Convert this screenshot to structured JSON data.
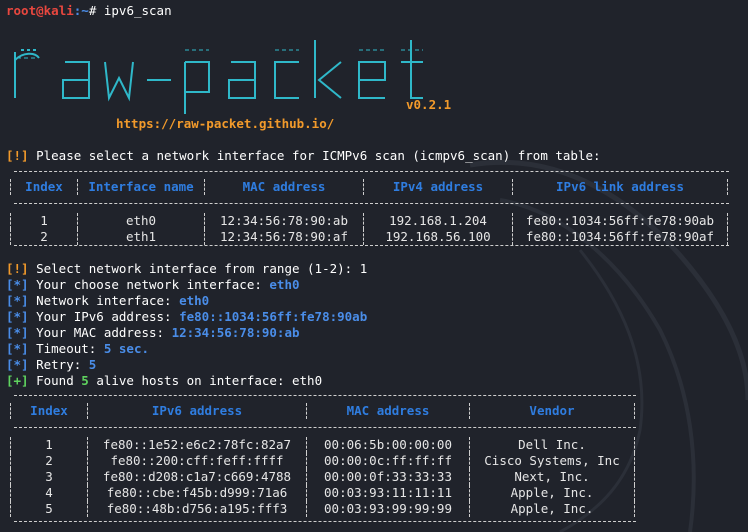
{
  "prompt": {
    "user": "root",
    "at": "@",
    "host": "kali",
    "path": ":~",
    "hash": "#",
    "command": " ipv6_scan"
  },
  "banner": {
    "version": "v0.2.1",
    "url": "https://raw-packet.github.io/"
  },
  "section1": {
    "select_msg_tag": "[!]",
    "select_msg": " Please select a network interface for ICMPv6 scan (icmpv6_scan) from table:",
    "headers": [
      "Index",
      "Interface name",
      "MAC address",
      "IPv4 address",
      "IPv6 link address"
    ],
    "rows": [
      [
        "1",
        "eth0",
        "12:34:56:78:90:ab",
        "192.168.1.204",
        "fe80::1034:56ff:fe78:90ab"
      ],
      [
        "2",
        "eth1",
        "12:34:56:78:90:af",
        "192.168.56.100",
        "fe80::1034:56ff:fe78:90af"
      ]
    ]
  },
  "log": [
    {
      "tag": "[!]",
      "kind": "orange",
      "text": " Select network interface from range (1-2): 1",
      "val": ""
    },
    {
      "tag": "[*]",
      "kind": "blue",
      "text": " Your choose network interface: ",
      "val": "eth0"
    },
    {
      "tag": "[*]",
      "kind": "blue",
      "text": " Network interface: ",
      "val": "eth0"
    },
    {
      "tag": "[*]",
      "kind": "blue",
      "text": " Your IPv6 address: ",
      "val": "fe80::1034:56ff:fe78:90ab"
    },
    {
      "tag": "[*]",
      "kind": "blue",
      "text": " Your MAC address: ",
      "val": "12:34:56:78:90:ab"
    },
    {
      "tag": "[*]",
      "kind": "blue",
      "text": " Timeout: ",
      "val": "5 sec."
    },
    {
      "tag": "[*]",
      "kind": "blue",
      "text": " Retry: ",
      "val": "5"
    },
    {
      "tag": "[+]",
      "kind": "green",
      "text": " Found ",
      "val": "5",
      "text2": " alive hosts on interface: ",
      "val2": "eth0"
    }
  ],
  "section2": {
    "headers": [
      "Index",
      "IPv6 address",
      "MAC address",
      "Vendor"
    ],
    "rows": [
      [
        "1",
        "fe80::1e52:e6c2:78fc:82a7",
        "00:06:5b:00:00:00",
        "Dell Inc."
      ],
      [
        "2",
        "fe80::200:cff:feff:ffff",
        "00:00:0c:ff:ff:ff",
        "Cisco Systems, Inc"
      ],
      [
        "3",
        "fe80::d208:c1a7:c669:4788",
        "00:00:0f:33:33:33",
        "Next, Inc."
      ],
      [
        "4",
        "fe80::cbe:f45b:d999:71a6",
        "00:03:93:11:11:11",
        "Apple, Inc."
      ],
      [
        "5",
        "fe80::48b:d756:a195:fff3",
        "00:03:93:99:99:99",
        "Apple, Inc."
      ]
    ]
  },
  "colors": {
    "bg": "#20232b",
    "red": "#e8473f",
    "blue": "#4a8de8",
    "cyan": "#2fb8c9",
    "orange": "#f29a2b",
    "green": "#5fd35f",
    "header": "#2f7de0"
  }
}
